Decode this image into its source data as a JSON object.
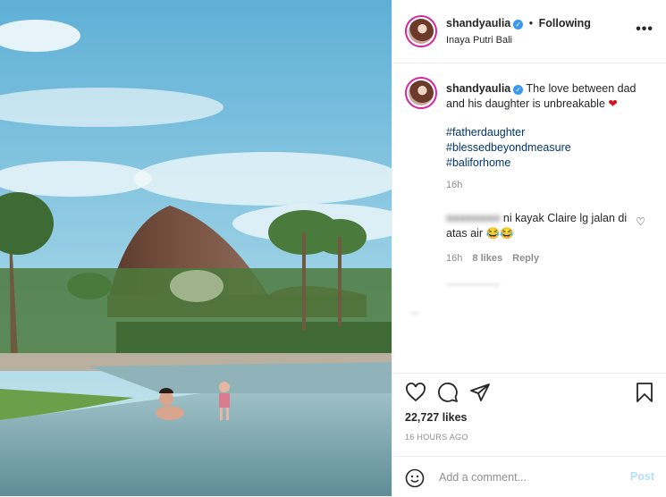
{
  "header": {
    "username": "shandyaulia",
    "separator": "•",
    "follow_state": "Following",
    "location": "Inaya Putri Bali",
    "more_icon": "more-horizontal-icon"
  },
  "caption": {
    "username": "shandyaulia",
    "text": "The love between dad and his daughter is unbreakable",
    "emoji": "❤",
    "hashtags": [
      "#fatherdaughter",
      "#blessedbeyondmeasure",
      "#baliforhome"
    ],
    "time": "16h"
  },
  "comment": {
    "username": "",
    "text": "ni kayak Claire lg jalan di atas air 😂😂",
    "time": "16h",
    "likes": "8 likes",
    "reply_label": "Reply"
  },
  "actions": {
    "likes": "22,727 likes",
    "posted_ago": "16 HOURS AGO"
  },
  "add_comment": {
    "placeholder": "Add a comment...",
    "post_label": "Post"
  },
  "colors": {
    "verified": "#3897f0",
    "hashtag": "#00376b",
    "post_button": "#b2dffc",
    "heart": "#d3131f"
  }
}
